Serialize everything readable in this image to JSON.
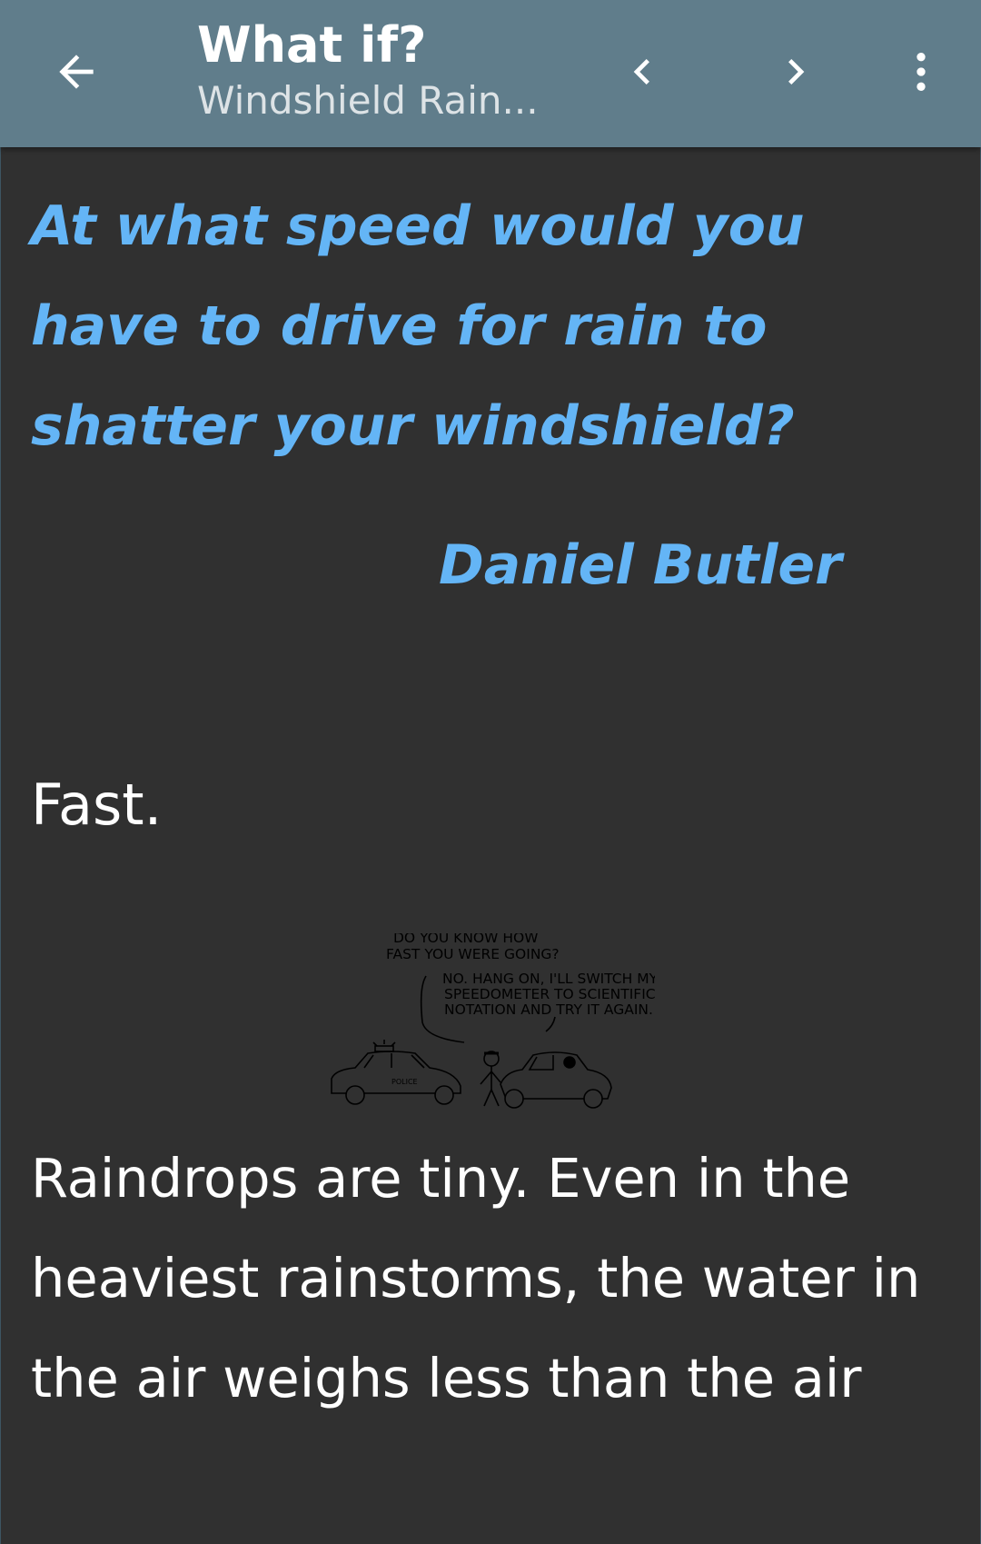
{
  "app_bar": {
    "title": "What if?",
    "subtitle": "Windshield Rain...",
    "icons": {
      "back": "arrow-left-icon",
      "previous": "chevron-left-icon",
      "next": "chevron-right-icon",
      "more": "more-vertical-icon"
    },
    "background_color": "#607d8b"
  },
  "article": {
    "question": "At what speed would you have to drive for rain to shatter your windshield?",
    "asker": "Daniel Butler",
    "answer_intro": "Fast.",
    "comic": {
      "speech_1_line_1": "DO YOU KNOW HOW",
      "speech_1_line_2": "FAST YOU WERE GOING?",
      "speech_2_line_1": "NO. HANG ON, I'LL SWITCH MY",
      "speech_2_line_2": "SPEEDOMETER TO SCIENTIFIC",
      "speech_2_line_3": "NOTATION AND TRY IT AGAIN.",
      "car_label": "POLICE"
    },
    "paragraph_1": "Raindrops are tiny. Even in the heaviest rainstorms, the water in the air weighs less than the air",
    "question_color": "#64b5f6",
    "text_color": "#ffffff",
    "background_color": "#303030"
  }
}
